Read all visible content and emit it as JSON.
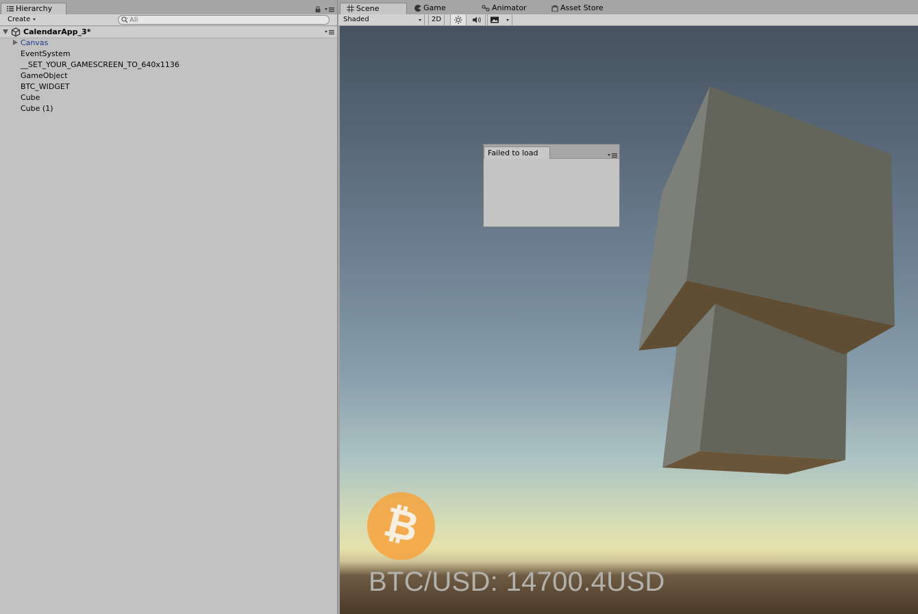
{
  "hierarchy": {
    "tab_label": "Hierarchy",
    "create_label": "Create",
    "search_placeholder": "All",
    "scene_name": "CalendarApp_3*",
    "items": [
      "Canvas",
      "EventSystem",
      "__SET_YOUR_GAMESCREEN_TO_640x1136",
      "GameObject",
      "BTC_WIDGET",
      "Cube",
      "Cube (1)"
    ],
    "canvas_color": "#1b3a8c"
  },
  "scene": {
    "tabs": [
      {
        "label": "Scene",
        "icon": "grid-icon",
        "active": true
      },
      {
        "label": "Game",
        "icon": "pacman-icon",
        "active": false
      },
      {
        "label": "Animator",
        "icon": "animator-icon",
        "active": false
      },
      {
        "label": "Asset Store",
        "icon": "store-bag-icon",
        "active": false
      }
    ],
    "toolbar": {
      "shading_mode": "Shaded",
      "mode_2d_label": "2D"
    },
    "failed_window_title": "Failed to load",
    "btc_price_text": "BTC/USD: 14700.4USD",
    "btc_symbol": "₿",
    "colors": {
      "bitcoin_orange": "#f7a23c",
      "price_text": "#b3b1ab",
      "cube_face": "#64655a",
      "cube_bottom": "#5f4d34"
    }
  }
}
